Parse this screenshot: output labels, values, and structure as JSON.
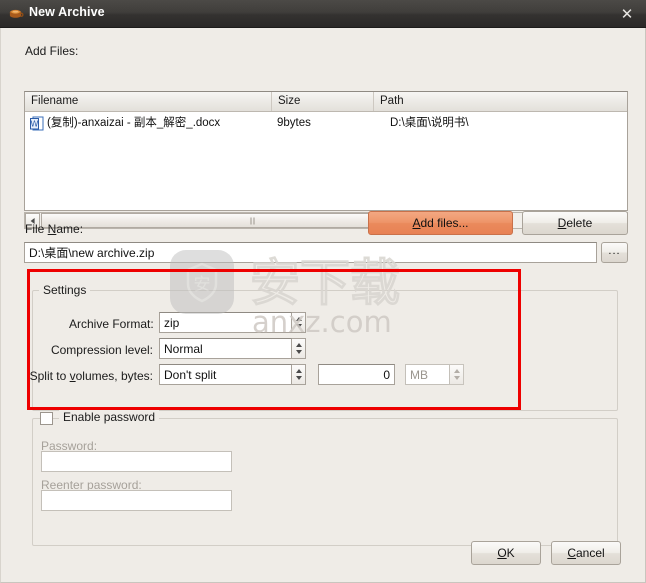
{
  "window": {
    "title": "New Archive",
    "icon": "archive-box-icon",
    "close_label": "✕"
  },
  "add_files_section": {
    "label": "Add Files:",
    "columns": [
      "Filename",
      "Size",
      "Path"
    ],
    "rows": [
      {
        "filename": "(复制)-anxaizai - 副本_解密_.docx",
        "size": "9bytes",
        "path": "D:\\桌面\\说明书\\",
        "icon": "word-document-icon"
      }
    ],
    "add_files_button": "Add files...",
    "add_files_accel": "A",
    "delete_button": "Delete",
    "delete_accel": "D"
  },
  "file_name_section": {
    "label": "File Name:",
    "label_accel": "N",
    "value": "D:\\桌面\\new archive.zip",
    "browse_button": "..."
  },
  "settings": {
    "title": "Settings",
    "archive_format": {
      "label": "Archive Format:",
      "value": "zip"
    },
    "compression_level": {
      "label": "Compression level:",
      "value": "Normal"
    },
    "split_to_volumes": {
      "label": "Split to volumes, bytes:",
      "label_accel": "v",
      "value": "Don't split",
      "amount": "0",
      "unit": "MB"
    }
  },
  "password_section": {
    "enable_label": "Enable password",
    "enabled": false,
    "password_label": "Password:",
    "password_value": "",
    "reenter_label": "Reenter password:",
    "reenter_value": ""
  },
  "footer": {
    "ok_button": "OK",
    "ok_accel": "O",
    "cancel_button": "Cancel",
    "cancel_accel": "C"
  },
  "watermark": {
    "text_cn": "安下载",
    "text_en": "anxz.com"
  },
  "colors": {
    "accent_button": "#ea8a5c",
    "annotation_rect": "#ee0000",
    "titlebar": "#3a3835",
    "client_bg": "#efece7"
  }
}
